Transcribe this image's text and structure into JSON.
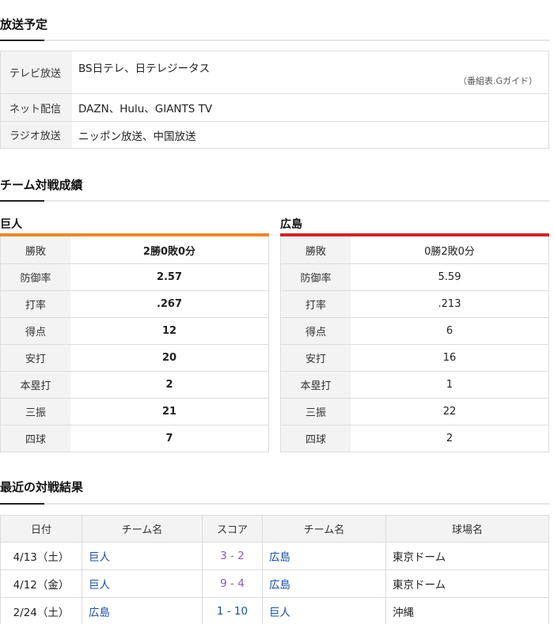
{
  "broadcast": {
    "title": "放送予定",
    "rows": [
      {
        "label": "テレビ放送",
        "value": "BS日テレ、日テレジータス",
        "note": "（番組表.Gガイド）"
      },
      {
        "label": "ネット配信",
        "value": "DAZN、Hulu、GIANTS TV"
      },
      {
        "label": "ラジオ放送",
        "value": "ニッポン放送、中国放送"
      }
    ]
  },
  "team_stats": {
    "title": "チーム対戦成績",
    "teams": [
      {
        "name": "巨人",
        "color": "#e8882e",
        "rows": [
          {
            "label": "勝敗",
            "value": "2勝0敗0分"
          },
          {
            "label": "防御率",
            "value": "2.57"
          },
          {
            "label": "打率",
            "value": ".267"
          },
          {
            "label": "得点",
            "value": "12"
          },
          {
            "label": "安打",
            "value": "20"
          },
          {
            "label": "本塁打",
            "value": "2"
          },
          {
            "label": "三振",
            "value": "21"
          },
          {
            "label": "四球",
            "value": "7"
          }
        ]
      },
      {
        "name": "広島",
        "color": "#c8282e",
        "rows": [
          {
            "label": "勝敗",
            "value": "0勝2敗0分"
          },
          {
            "label": "防御率",
            "value": "5.59"
          },
          {
            "label": "打率",
            "value": ".213"
          },
          {
            "label": "得点",
            "value": "6"
          },
          {
            "label": "安打",
            "value": "16"
          },
          {
            "label": "本塁打",
            "value": "1"
          },
          {
            "label": "三振",
            "value": "22"
          },
          {
            "label": "四球",
            "value": "2"
          }
        ]
      }
    ]
  },
  "recent_results": {
    "title": "最近の対戦結果",
    "headers": {
      "date": "日付",
      "team1": "チーム名",
      "score": "スコア",
      "team2": "チーム名",
      "venue": "球場名"
    },
    "rows": [
      {
        "date": "4/13（土）",
        "team1": "巨人",
        "score": "3 - 2",
        "team2": "広島",
        "venue": "東京ドーム"
      },
      {
        "date": "4/12（金）",
        "team1": "巨人",
        "score": "9 - 4",
        "team2": "広島",
        "venue": "東京ドーム"
      },
      {
        "date": "2/24（土）",
        "team1": "広島",
        "score": "1 - 10",
        "team2": "巨人",
        "venue": "沖縄"
      }
    ]
  }
}
